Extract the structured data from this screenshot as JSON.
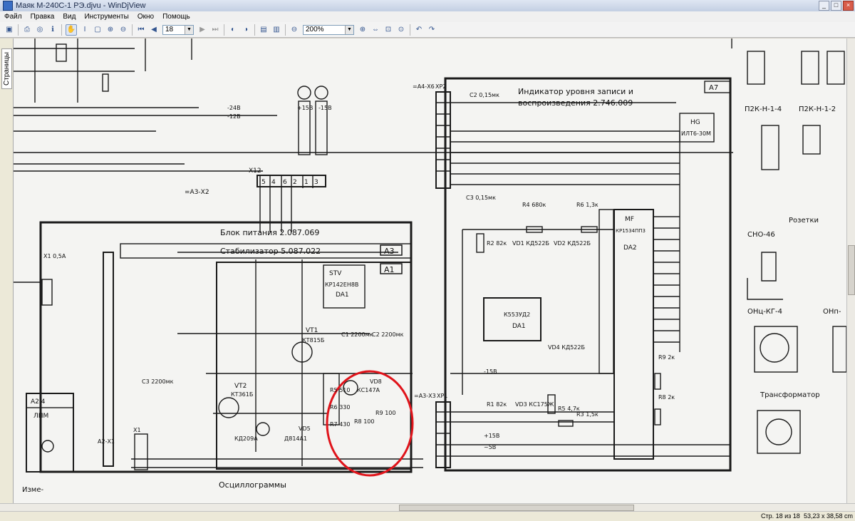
{
  "window": {
    "title": "Маяк М-240С-1 РЭ.djvu - WinDjView"
  },
  "menu": [
    "Файл",
    "Правка",
    "Вид",
    "Инструменты",
    "Окно",
    "Помощь"
  ],
  "toolbar": {
    "page_value": "18",
    "zoom_value": "200%"
  },
  "sidebar": {
    "tab_label": "Страницы"
  },
  "status": {
    "page_info": "Стр. 18 из 18",
    "page_size": "53,23 x 38,58 cm"
  },
  "schematic": {
    "blocks": {
      "a3_code": "А3",
      "a3_title": "Блок питания 2.087.069",
      "a1_code": "А1",
      "a1_title": "Стабилизатор 5.087.022",
      "a7_code": "А7",
      "a7_title_1": "Индикатор уровня записи и",
      "a7_title_2": "воспроизведения 2.746.009",
      "a24_code": "А2.4",
      "a24_lamp": "ЛПМ"
    },
    "connectors": {
      "x12": "X12",
      "a3x2": "=А3-Х2",
      "a4x6": "=А4-Х6",
      "xp2": "ХР2",
      "xp1": "ХР1",
      "a3x3": "=А3-Х3",
      "x1": "X1",
      "a2x1": "А2-Х1",
      "x1_fuse": "X1 0,5А",
      "pins_x12": [
        "5",
        "4",
        "6",
        "2",
        "1",
        "3"
      ]
    },
    "rails": {
      "minus24": "-24В",
      "minus12": "-12В",
      "plus15_1": "+15В",
      "minus15_1": "-15В",
      "plus15_2": "+15В",
      "minus15_2": "-15В",
      "tilde5v": "~5В"
    },
    "components": {
      "stv": "STV",
      "stv_part": "КР142ЕН8В",
      "stv_da": "DA1",
      "vt1": "VT1",
      "vt1_part": "КТ815Б",
      "vt2": "VT2",
      "vt2_part": "КТ361Б",
      "vd8": "VD8",
      "vd8_part": "КС147А",
      "vd5": "VD5",
      "vd5_part": "Д814А1",
      "vd4_part": "КД209А",
      "r5": "R5 510",
      "r6": "R6 330",
      "r7": "R7 430",
      "r8": "R8 100",
      "r9": "R9 100",
      "c1": "C1 2200мк",
      "c2": "C2 2200мк",
      "c3": "C3 2200мк",
      "da1_op": "К553УД2",
      "da1_op_label": "DA1",
      "da2": "КР1534ПП3",
      "da2_label": "DA2",
      "mf": "MF",
      "hg": "HG",
      "hg_part": "ИЛТ6-30М",
      "r4": "R4 680к",
      "r6b": "R6 1,3к",
      "r2": "R2 82к",
      "r1": "R1 82к",
      "vd1": "VD1 КД522Б",
      "vd2": "VD2 КД522Б",
      "vd3": "VD3 КС175Ж",
      "vd4b": "VD4 КД522Б",
      "c3b": "C3 0,15мк",
      "c2b": "C2 0,15мк",
      "r9b": "R9 2к",
      "r8b": "R8 2к",
      "r3b": "R3 1,5к",
      "r5b": "R5 4,7к"
    },
    "right_panel": {
      "p2k1": "П2К-Н-1-4",
      "p2k2": "П2К-Н-1-2",
      "rozetki": "Розетки",
      "sno": "СНО-46",
      "onts": "ОНц-КГ-4",
      "onp": "ОНп-",
      "transformer": "Трансформатор"
    },
    "bottom": {
      "osc": "Осциллограммы",
      "izme": "Изме-",
      "ne": "-"
    }
  }
}
